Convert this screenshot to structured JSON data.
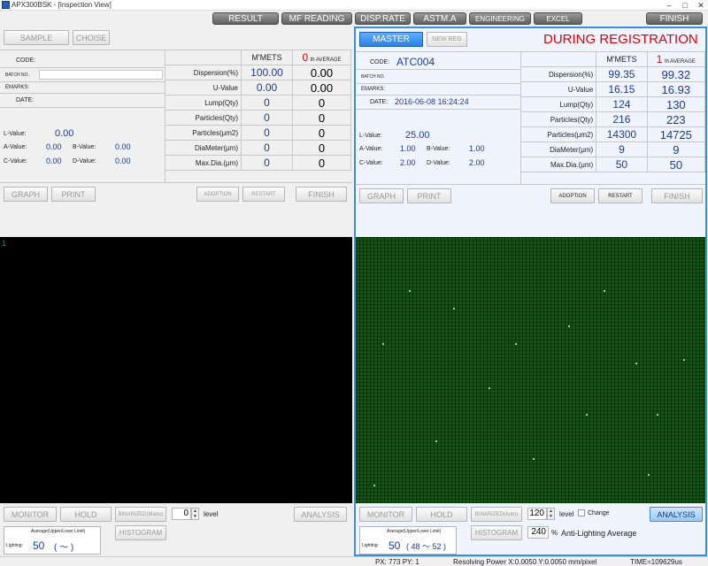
{
  "window": {
    "title": "APX300BSK - [Inspection View]",
    "min": "–",
    "max": "□",
    "close": "✕"
  },
  "toolbar": {
    "result": "RESULT",
    "mf_reading": "MF READING",
    "disp_rate": "DISP.RATE",
    "astm": "ASTM.A",
    "engineering": "ENGINEERING",
    "excel": "EXCEL",
    "finish": "FINISH"
  },
  "left": {
    "sample": "SAMPLE",
    "choise": "CHOISE",
    "code_label": "CODE:",
    "batch_label": "BATCH NO.",
    "emarks_label": "EMARKS:",
    "date_label": "DATE:",
    "mmets": "M'METS",
    "avg_num": "0",
    "avg_label": "th AVERAGE",
    "rows": [
      {
        "label": "Dispersion(%)",
        "v": "100.00",
        "a": "0.00"
      },
      {
        "label": "U-Value",
        "v": "0.00",
        "a": "0.00"
      },
      {
        "label": "Lump(Qty)",
        "v": "0",
        "a": "0"
      },
      {
        "label": "Particles(Qty)",
        "v": "0",
        "a": "0"
      },
      {
        "label": "Particles(μm2)",
        "v": "0",
        "a": "0"
      },
      {
        "label": "DiaMeter(μm)",
        "v": "0",
        "a": "0"
      },
      {
        "label": "Max.Dia.(μm)",
        "v": "0",
        "a": "0"
      }
    ],
    "lvalue_label": "L-Value:",
    "lvalue": "0.00",
    "avalue_label": "A-Value:",
    "avalue": "0.00",
    "bvalue_label": "B-Value:",
    "bvalue": "0.00",
    "cvalue_label": "C-Value:",
    "cvalue": "0.00",
    "dvalue_label": "D-Value:",
    "dvalue": "0.00",
    "graph": "GRAPH",
    "print": "PRINT",
    "adoption": "ADOPTION",
    "restart": "RESTART",
    "finish": "FINISH"
  },
  "right": {
    "master": "MASTER",
    "new_reg": "NEW REG",
    "registration": "DURING REGISTRATION",
    "code_label": "CODE:",
    "code": "ATC004",
    "batch_label": "BATCH NO.",
    "emarks_label": "EMARKS:",
    "date_label": "DATE:",
    "date": "2016-06-08 16:24:24",
    "mmets": "M'METS",
    "avg_num": "1",
    "avg_label": "th AVERAGE",
    "rows": [
      {
        "label": "Dispersion(%)",
        "v": "99.35",
        "a": "99.32"
      },
      {
        "label": "U-Value",
        "v": "16.15",
        "a": "16.93"
      },
      {
        "label": "Lump(Qty)",
        "v": "124",
        "a": "130"
      },
      {
        "label": "Particles(Qty)",
        "v": "216",
        "a": "223"
      },
      {
        "label": "Particles(μm2)",
        "v": "14300",
        "a": "14725"
      },
      {
        "label": "DiaMeter(μm)",
        "v": "9",
        "a": "9"
      },
      {
        "label": "Max.Dia.(μm)",
        "v": "50",
        "a": "50"
      }
    ],
    "lvalue_label": "L-Value:",
    "lvalue": "25.00",
    "avalue_label": "A-Value:",
    "avalue": "1.00",
    "bvalue_label": "B-Value:",
    "bvalue": "1.00",
    "cvalue_label": "C-Value:",
    "cvalue": "2.00",
    "dvalue_label": "D-Value:",
    "dvalue": "2.00",
    "graph": "GRAPH",
    "print": "PRINT",
    "adoption": "ADOPTION",
    "restart": "RESTART",
    "finish": "FINISH"
  },
  "views": {
    "left_channel": "1"
  },
  "ctrl_left": {
    "monitor": "MONITOR",
    "hold": "HOLD",
    "binarized": "BINARIZED(Manu)",
    "level_value": "0",
    "level_label": "level",
    "analysis": "ANALYSIS",
    "histogram": "HISTOGRAM",
    "avg_title": "Average(Upper/Lover Limit)",
    "lighting_label": "Lighting:",
    "lighting": "50",
    "range": "(     ～     )"
  },
  "ctrl_right": {
    "monitor": "MONITOR",
    "hold": "HOLD",
    "binarized": "BINARIZED(Auto)",
    "level_value": "120",
    "level_label": "level",
    "change_label": "Change",
    "analysis": "ANALYSIS",
    "histogram": "HISTOGRAM",
    "pct_value": "240",
    "pct_label": "%",
    "anti_label": "Anti-Lighting Average",
    "avg_title": "Average(Upper/Lover Limit)",
    "lighting_label": "Lighting:",
    "lighting": "50",
    "range": "( 48 ～ 52 )"
  },
  "status": {
    "px": "PX: 773 PY:   1",
    "resolving": "Resolving Power X:0.0050  Y:0.0050 mm/pixel",
    "time": "TIME=109629us"
  }
}
